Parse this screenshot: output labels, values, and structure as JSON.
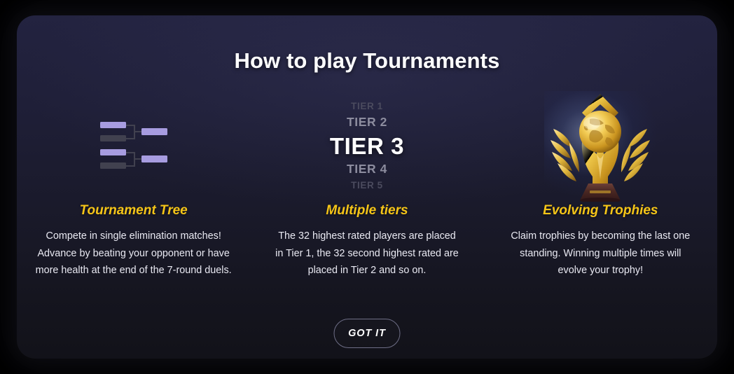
{
  "modal": {
    "title": "How to play Tournaments",
    "confirm_label": "GOT IT",
    "accent_color": "#f5c518",
    "bracket_win_color": "#a79ce0",
    "bracket_lose_color": "#41414f",
    "background_top": "#232340",
    "background_bottom": "#121219"
  },
  "columns": [
    {
      "art": "tournament-bracket",
      "heading": "Tournament Tree",
      "body": "Compete in single elimination matches!\nAdvance by beating your opponent or have\nmore health at the end of the 7-round duels."
    },
    {
      "art": "tier-ladder",
      "heading": "Multiple tiers",
      "body": "The 32 highest rated players are placed\nin Tier 1, the 32 second highest rated are\nplaced in Tier 2 and so on."
    },
    {
      "art": "golden-trophy",
      "heading": "Evolving Trophies",
      "body": "Claim trophies by becoming the last one\nstanding.  Winning multiple times will\nevolve your trophy!"
    }
  ],
  "tiers": [
    {
      "label": "TIER 1",
      "emphasis": "far"
    },
    {
      "label": "TIER 2",
      "emphasis": "near"
    },
    {
      "label": "TIER 3",
      "emphasis": "focus"
    },
    {
      "label": "TIER 4",
      "emphasis": "near"
    },
    {
      "label": "TIER 5",
      "emphasis": "far"
    }
  ]
}
